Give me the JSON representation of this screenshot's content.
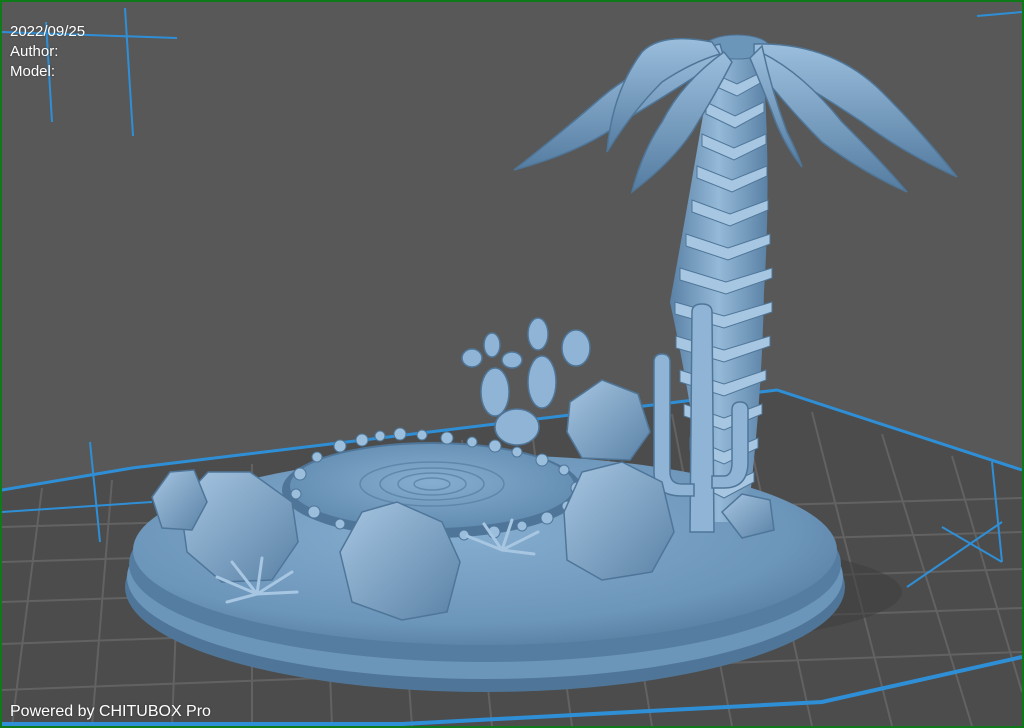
{
  "overlay": {
    "date": "2022/09/25",
    "author_label": "Author:",
    "model_label": "Model:"
  },
  "footer": {
    "powered_by": "Powered by CHITUBOX Pro"
  },
  "colors": {
    "frame_border": "#0f7a1a",
    "background": "#585858",
    "build_plate": "#4c4c4c",
    "grid_line": "#626262",
    "plate_edge": "#2f8fd6",
    "model": "#7ea6c9",
    "model_shadow": "#4f7698",
    "model_highlight": "#b8d3ea"
  },
  "viewport": {
    "scene": "3d-model-preview",
    "model_parts": [
      "oval-base",
      "pond",
      "rocks",
      "palm-tree",
      "cactus",
      "prickly-pear-cactus",
      "agave-plants"
    ]
  }
}
